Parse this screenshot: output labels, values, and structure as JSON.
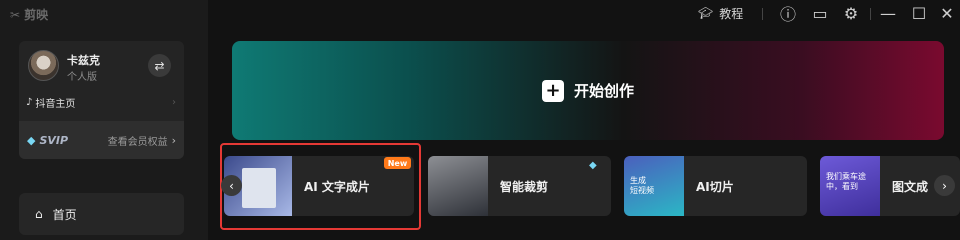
{
  "app": {
    "logo_text": "剪映"
  },
  "topbar": {
    "tutorial_label": "教程"
  },
  "user": {
    "name": "卡兹克",
    "plan": "个人版",
    "douyin_link": "抖音主页",
    "svip_badge": "SVIP",
    "svip_link": "查看会员权益"
  },
  "nav": {
    "home_label": "首页"
  },
  "main": {
    "start_label": "开始创作"
  },
  "features": [
    {
      "label": "AI 文字成片",
      "badge": "New"
    },
    {
      "label": "智能裁剪"
    },
    {
      "label": "AI切片",
      "thumb_text": "生成\n短视频"
    },
    {
      "label": "图文成",
      "thumb_text": "我们乘车途\n中，看到"
    }
  ],
  "colors": {
    "accent_new": "#ff7a1a",
    "highlight": "#e53935",
    "banner_left": "#0f7a74",
    "banner_right": "#7a0a2f"
  }
}
